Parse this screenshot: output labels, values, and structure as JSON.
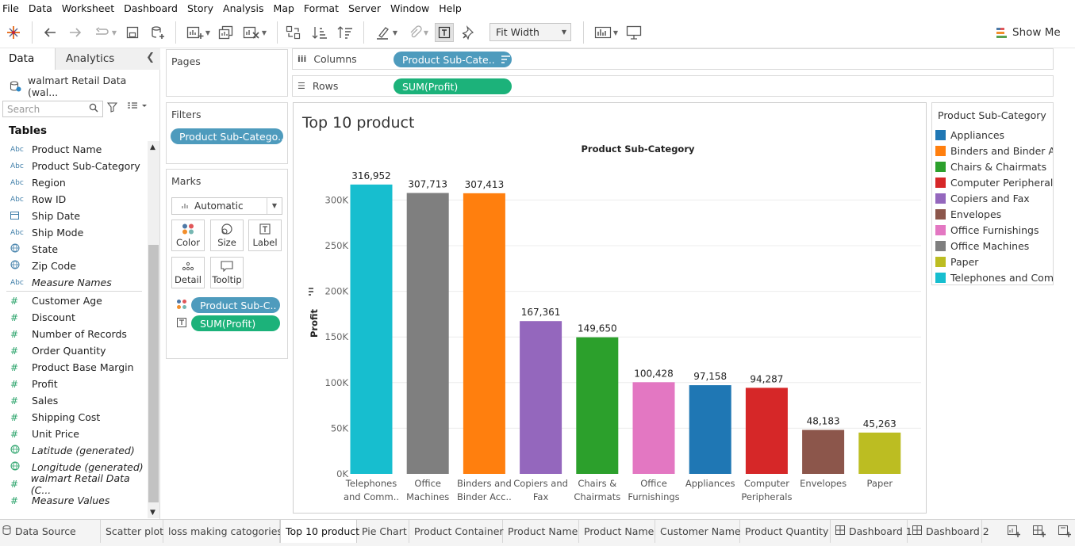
{
  "menu": [
    "File",
    "Data",
    "Worksheet",
    "Dashboard",
    "Story",
    "Analysis",
    "Map",
    "Format",
    "Server",
    "Window",
    "Help"
  ],
  "toolbar": {
    "fit_label": "Fit Width",
    "show_me_label": "Show Me"
  },
  "data_pane": {
    "tab_data": "Data",
    "tab_analytics": "Analytics",
    "datasource": "walmart Retail Data (wal...",
    "search_placeholder": "Search",
    "tables_header": "Tables",
    "dimensions": [
      {
        "type": "Abc",
        "name": "Product Name"
      },
      {
        "type": "Abc",
        "name": "Product Sub-Category"
      },
      {
        "type": "Abc",
        "name": "Region"
      },
      {
        "type": "Abc",
        "name": "Row ID"
      },
      {
        "type": "date",
        "name": "Ship Date"
      },
      {
        "type": "Abc",
        "name": "Ship Mode"
      },
      {
        "type": "geo",
        "name": "State"
      },
      {
        "type": "geo",
        "name": "Zip Code"
      },
      {
        "type": "Abc",
        "name": "Measure Names",
        "italic": true
      }
    ],
    "measures": [
      {
        "type": "num",
        "name": "Customer Age"
      },
      {
        "type": "num",
        "name": "Discount"
      },
      {
        "type": "num",
        "name": "Number of Records"
      },
      {
        "type": "num",
        "name": "Order Quantity"
      },
      {
        "type": "num",
        "name": "Product Base Margin"
      },
      {
        "type": "num",
        "name": "Profit"
      },
      {
        "type": "num",
        "name": "Sales"
      },
      {
        "type": "num",
        "name": "Shipping Cost"
      },
      {
        "type": "num",
        "name": "Unit Price"
      },
      {
        "type": "geo",
        "name": "Latitude (generated)",
        "italic": true
      },
      {
        "type": "geo",
        "name": "Longitude (generated)",
        "italic": true
      },
      {
        "type": "num",
        "name": "walmart Retail Data (C...",
        "italic": true
      },
      {
        "type": "num",
        "name": "Measure Values",
        "italic": true
      }
    ]
  },
  "pages_label": "Pages",
  "filters": {
    "label": "Filters",
    "pill": "Product Sub-Catego.."
  },
  "marks": {
    "label": "Marks",
    "type": "Automatic",
    "buttons": [
      "Color",
      "Size",
      "Label",
      "Detail",
      "Tooltip"
    ],
    "pill_color": "Product Sub-C..",
    "pill_label": "SUM(Profit)"
  },
  "columns": {
    "label": "Columns",
    "pill": "Product Sub-Cate.."
  },
  "rows": {
    "label": "Rows",
    "pill": "SUM(Profit)"
  },
  "view": {
    "title": "Top 10 product"
  },
  "chart_data": {
    "type": "bar",
    "title": "Product Sub-Category",
    "xlabel": "",
    "ylabel": "Profit",
    "ylim": [
      0,
      340000
    ],
    "yticks": [
      0,
      50000,
      100000,
      150000,
      200000,
      250000,
      300000
    ],
    "ytick_labels": [
      "0K",
      "50K",
      "100K",
      "150K",
      "200K",
      "250K",
      "300K"
    ],
    "grid": true,
    "categories": [
      "Telephones and Comm..",
      "Office Machines",
      "Binders and Binder Acc..",
      "Copiers and Fax",
      "Chairs & Chairmats",
      "Office Furnishings",
      "Appliances",
      "Computer Peripherals",
      "Envelopes",
      "Paper"
    ],
    "category_lines": [
      [
        "Telephones",
        "and Comm.."
      ],
      [
        "Office",
        "Machines"
      ],
      [
        "Binders and",
        "Binder Acc.."
      ],
      [
        "Copiers and",
        "Fax"
      ],
      [
        "Chairs &",
        "Chairmats"
      ],
      [
        "Office",
        "Furnishings"
      ],
      [
        "Appliances"
      ],
      [
        "Computer",
        "Peripherals"
      ],
      [
        "Envelopes"
      ],
      [
        "Paper"
      ]
    ],
    "values": [
      316952,
      307713,
      307413,
      167361,
      149650,
      100428,
      97158,
      94287,
      48183,
      45263
    ],
    "value_labels": [
      "316,952",
      "307,713",
      "307,413",
      "167,361",
      "149,650",
      "100,428",
      "97,158",
      "94,287",
      "48,183",
      "45,263"
    ],
    "colors": [
      "#17becf",
      "#7f7f7f",
      "#ff7f0e",
      "#9467bd",
      "#2ca02c",
      "#e377c2",
      "#1f77b4",
      "#d62728",
      "#8c564b",
      "#bcbd22"
    ]
  },
  "legend": {
    "title": "Product Sub-Category",
    "items": [
      {
        "label": "Appliances",
        "color": "#1f77b4"
      },
      {
        "label": "Binders and Binder A..",
        "color": "#ff7f0e"
      },
      {
        "label": "Chairs & Chairmats",
        "color": "#2ca02c"
      },
      {
        "label": "Computer Peripherals",
        "color": "#d62728"
      },
      {
        "label": "Copiers and Fax",
        "color": "#9467bd"
      },
      {
        "label": "Envelopes",
        "color": "#8c564b"
      },
      {
        "label": "Office Furnishings",
        "color": "#e377c2"
      },
      {
        "label": "Office Machines",
        "color": "#7f7f7f"
      },
      {
        "label": "Paper",
        "color": "#bcbd22"
      },
      {
        "label": "Telephones and Com..",
        "color": "#17becf"
      }
    ]
  },
  "sheet_tabs": [
    {
      "label": "Data Source",
      "icon": "datasource"
    },
    {
      "label": "Scatter plot"
    },
    {
      "label": "loss making catogories"
    },
    {
      "label": "Top 10 product",
      "active": true
    },
    {
      "label": "Pie Chart"
    },
    {
      "label": "Product Container"
    },
    {
      "label": "Product Name"
    },
    {
      "label": "Product Name"
    },
    {
      "label": "Customer Name"
    },
    {
      "label": "Product Quantity"
    },
    {
      "label": "Dashboard 1",
      "icon": "dashboard"
    },
    {
      "label": "Dashboard 2",
      "icon": "dashboard"
    }
  ]
}
